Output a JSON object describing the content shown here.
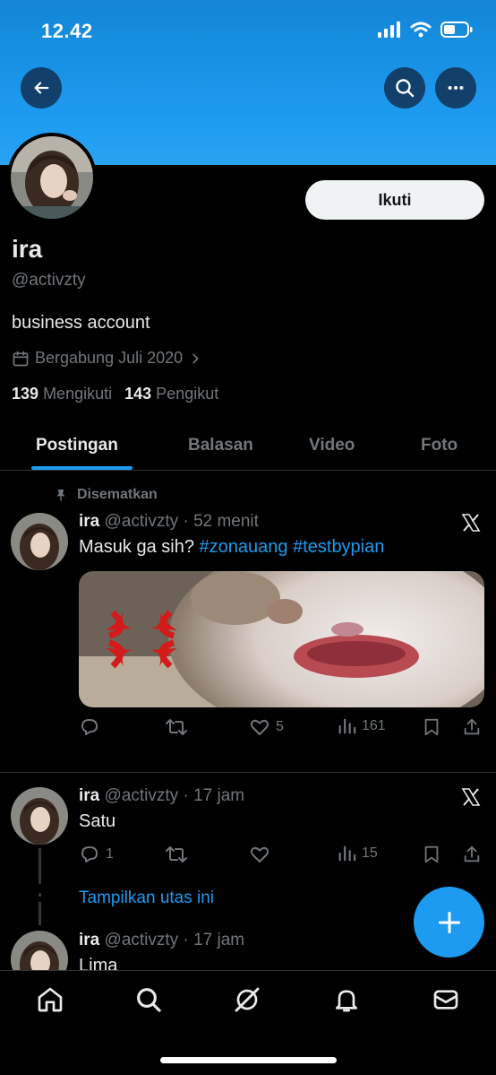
{
  "status_bar": {
    "time": "12.42"
  },
  "profile": {
    "name": "ira",
    "handle": "@activzty",
    "bio": "business account",
    "joined": "Bergabung Juli 2020",
    "following_count": "139",
    "following_label": "Mengikuti",
    "followers_count": "143",
    "followers_label": "Pengikut",
    "follow_button": "Ikuti"
  },
  "tabs": [
    {
      "label": "Postingan",
      "active": true
    },
    {
      "label": "Balasan",
      "active": false
    },
    {
      "label": "Video",
      "active": false
    },
    {
      "label": "Foto",
      "active": false
    }
  ],
  "tweets": [
    {
      "pinned_label": "Disematkan",
      "name": "ira",
      "handle": "@activzty",
      "time": "52 menit",
      "text": "Masuk ga sih?",
      "hashtags": [
        "#zonauang",
        "#testbypian"
      ],
      "replies": "",
      "retweets": "",
      "likes": "5",
      "views": "161"
    },
    {
      "name": "ira",
      "handle": "@activzty",
      "time": "17 jam",
      "text": "Satu",
      "replies": "1",
      "retweets": "",
      "likes": "",
      "views": "15"
    },
    {
      "name": "ira",
      "handle": "@activzty",
      "time": "17 jam",
      "text": "Lima"
    }
  ],
  "show_thread": "Tampilkan utas ini",
  "colors": {
    "accent": "#1d9bf0",
    "background": "#000000",
    "muted": "#71767b",
    "text": "#e7e9ea"
  },
  "icons": [
    "back-arrow-icon",
    "search-icon",
    "more-icon",
    "calendar-icon",
    "chevron-right-icon",
    "pin-icon",
    "x-logo-icon",
    "reply-icon",
    "retweet-icon",
    "like-icon",
    "views-icon",
    "bookmark-icon",
    "share-icon",
    "plus-icon",
    "home-icon",
    "explore-icon",
    "grok-icon",
    "notifications-icon",
    "messages-icon"
  ]
}
